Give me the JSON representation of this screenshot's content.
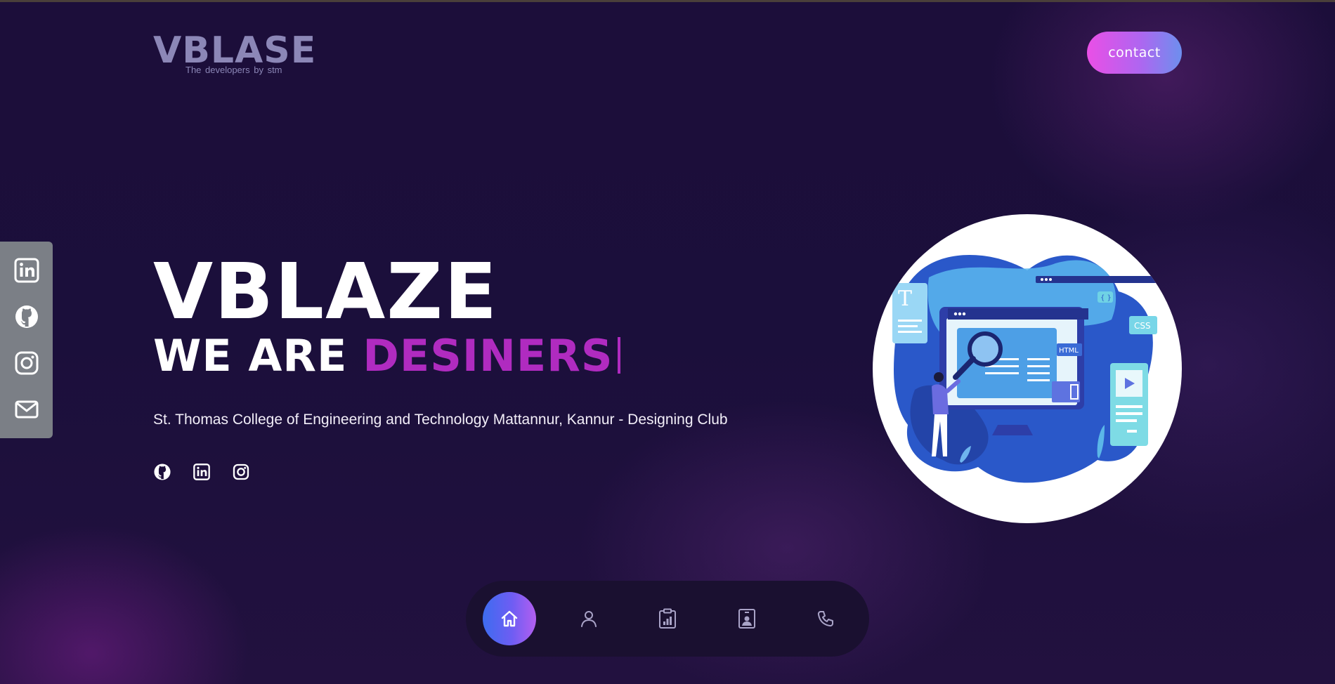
{
  "brand": {
    "logo_text": "VBLASE",
    "tagline": "The developers by stm"
  },
  "header": {
    "contact_label": "contact"
  },
  "sidebar": {
    "icons": [
      "linkedin-icon",
      "github-icon",
      "instagram-icon",
      "mail-icon"
    ]
  },
  "hero": {
    "title": "VBLAZE",
    "subtitle_prefix": "WE ARE",
    "subtitle_typed": "DESINERS",
    "description": "St. Thomas College of Engineering and Technology Mattannur, Kannur - Designing Club",
    "social_icons": [
      "github-icon",
      "linkedin-icon",
      "instagram-icon"
    ]
  },
  "illustration": {
    "labels": [
      "T",
      "CSS",
      "HTML",
      "{ }"
    ]
  },
  "bottom_nav": {
    "items": [
      "home-icon",
      "user-icon",
      "clipboard-chart-icon",
      "id-card-icon",
      "phone-icon"
    ],
    "active": "home-icon"
  },
  "colors": {
    "background": "#1b0f3b",
    "accent_purple": "#b02bc0",
    "contact_gradient_start": "#ea4fe6",
    "contact_gradient_end": "#6d8fee",
    "sidebar_bg": "#7b7f86"
  }
}
